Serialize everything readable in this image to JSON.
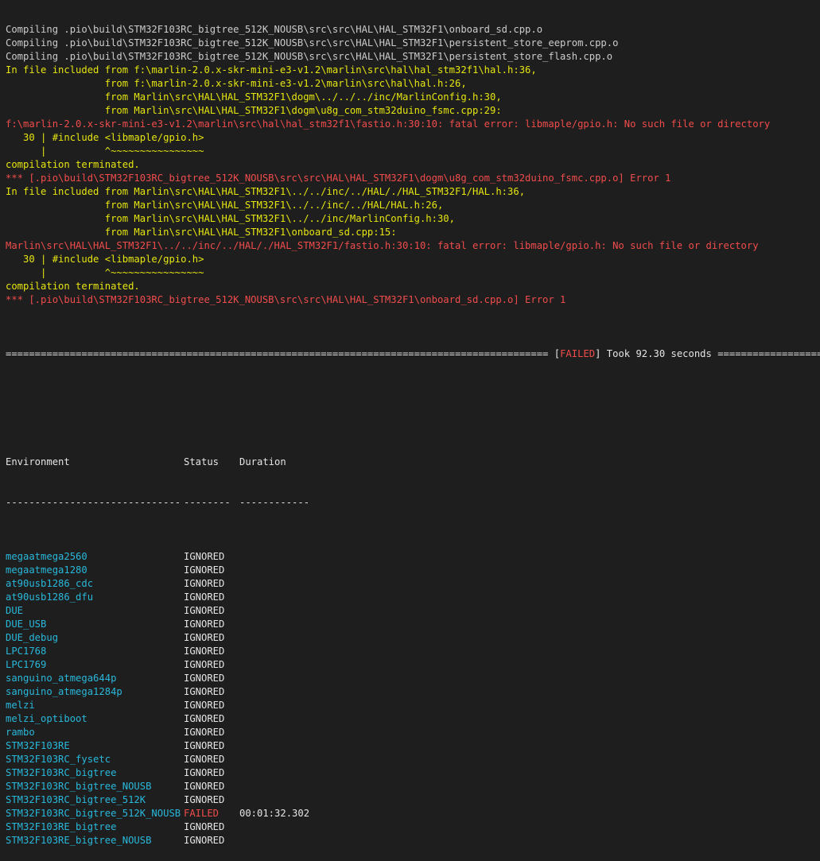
{
  "log": [
    {
      "t": "Compiling .pio\\build\\STM32F103RC_bigtree_512K_NOUSB\\src\\src\\HAL\\HAL_STM32F1\\onboard_sd.cpp.o",
      "c": "gray"
    },
    {
      "t": "Compiling .pio\\build\\STM32F103RC_bigtree_512K_NOUSB\\src\\src\\HAL\\HAL_STM32F1\\persistent_store_eeprom.cpp.o",
      "c": "gray"
    },
    {
      "t": "Compiling .pio\\build\\STM32F103RC_bigtree_512K_NOUSB\\src\\src\\HAL\\HAL_STM32F1\\persistent_store_flash.cpp.o",
      "c": "gray"
    },
    {
      "t": "In file included from f:\\marlin-2.0.x-skr-mini-e3-v1.2\\marlin\\src\\hal\\hal_stm32f1\\hal.h:36,",
      "c": "yellow"
    },
    {
      "t": "                 from f:\\marlin-2.0.x-skr-mini-e3-v1.2\\marlin\\src\\hal\\hal.h:26,",
      "c": "yellow"
    },
    {
      "t": "                 from Marlin\\src\\HAL\\HAL_STM32F1\\dogm\\../../../inc/MarlinConfig.h:30,",
      "c": "yellow"
    },
    {
      "t": "                 from Marlin\\src\\HAL\\HAL_STM32F1\\dogm\\u8g_com_stm32duino_fsmc.cpp:29:",
      "c": "yellow"
    },
    {
      "t": "f:\\marlin-2.0.x-skr-mini-e3-v1.2\\marlin\\src\\hal\\hal_stm32f1\\fastio.h:30:10: fatal error: libmaple/gpio.h: No such file or directory",
      "c": "red"
    },
    {
      "t": "   30 | #include <libmaple/gpio.h>",
      "c": "yellow"
    },
    {
      "t": "      |          ^~~~~~~~~~~~~~~~~",
      "c": "yellow"
    },
    {
      "t": "compilation terminated.",
      "c": "yellow"
    },
    {
      "t": "*** [.pio\\build\\STM32F103RC_bigtree_512K_NOUSB\\src\\src\\HAL\\HAL_STM32F1\\dogm\\u8g_com_stm32duino_fsmc.cpp.o] Error 1",
      "c": "red"
    },
    {
      "t": "In file included from Marlin\\src\\HAL\\HAL_STM32F1\\../../inc/../HAL/./HAL_STM32F1/HAL.h:36,",
      "c": "yellow"
    },
    {
      "t": "                 from Marlin\\src\\HAL\\HAL_STM32F1\\../../inc/../HAL/HAL.h:26,",
      "c": "yellow"
    },
    {
      "t": "                 from Marlin\\src\\HAL\\HAL_STM32F1\\../../inc/MarlinConfig.h:30,",
      "c": "yellow"
    },
    {
      "t": "                 from Marlin\\src\\HAL\\HAL_STM32F1\\onboard_sd.cpp:15:",
      "c": "yellow"
    },
    {
      "t": "Marlin\\src\\HAL\\HAL_STM32F1\\../../inc/../HAL/./HAL_STM32F1/fastio.h:30:10: fatal error: libmaple/gpio.h: No such file or directory",
      "c": "red"
    },
    {
      "t": "   30 | #include <libmaple/gpio.h>",
      "c": "yellow"
    },
    {
      "t": "      |          ^~~~~~~~~~~~~~~~~",
      "c": "yellow"
    },
    {
      "t": "compilation terminated.",
      "c": "yellow"
    },
    {
      "t": "*** [.pio\\build\\STM32F103RC_bigtree_512K_NOUSB\\src\\src\\HAL\\HAL_STM32F1\\onboard_sd.cpp.o] Error 1",
      "c": "red"
    }
  ],
  "summary": {
    "rule_left": "=============================================================================================",
    "bracket_open": "[",
    "failed": "FAILED",
    "took": "] Took 92.30 seconds ",
    "rule_right": "=================================="
  },
  "table": {
    "headers": {
      "environment": "Environment",
      "status": "Status",
      "duration": "Duration"
    },
    "dividers": {
      "environment": "------------------------------",
      "status": "--------",
      "duration": "------------"
    },
    "rows": [
      {
        "env": "megaatmega2560",
        "status": "IGNORED",
        "duration": ""
      },
      {
        "env": "megaatmega1280",
        "status": "IGNORED",
        "duration": ""
      },
      {
        "env": "at90usb1286_cdc",
        "status": "IGNORED",
        "duration": ""
      },
      {
        "env": "at90usb1286_dfu",
        "status": "IGNORED",
        "duration": ""
      },
      {
        "env": "DUE",
        "status": "IGNORED",
        "duration": ""
      },
      {
        "env": "DUE_USB",
        "status": "IGNORED",
        "duration": ""
      },
      {
        "env": "DUE_debug",
        "status": "IGNORED",
        "duration": ""
      },
      {
        "env": "LPC1768",
        "status": "IGNORED",
        "duration": ""
      },
      {
        "env": "LPC1769",
        "status": "IGNORED",
        "duration": ""
      },
      {
        "env": "sanguino_atmega644p",
        "status": "IGNORED",
        "duration": ""
      },
      {
        "env": "sanguino_atmega1284p",
        "status": "IGNORED",
        "duration": ""
      },
      {
        "env": "melzi",
        "status": "IGNORED",
        "duration": ""
      },
      {
        "env": "melzi_optiboot",
        "status": "IGNORED",
        "duration": ""
      },
      {
        "env": "rambo",
        "status": "IGNORED",
        "duration": ""
      },
      {
        "env": "STM32F103RE",
        "status": "IGNORED",
        "duration": ""
      },
      {
        "env": "STM32F103RC_fysetc",
        "status": "IGNORED",
        "duration": ""
      },
      {
        "env": "STM32F103RC_bigtree",
        "status": "IGNORED",
        "duration": ""
      },
      {
        "env": "STM32F103RC_bigtree_NOUSB",
        "status": "IGNORED",
        "duration": ""
      },
      {
        "env": "STM32F103RC_bigtree_512K",
        "status": "IGNORED",
        "duration": ""
      },
      {
        "env": "STM32F103RC_bigtree_512K_NOUSB",
        "status": "FAILED",
        "duration": "00:01:32.302"
      },
      {
        "env": "STM32F103RE_bigtree",
        "status": "IGNORED",
        "duration": ""
      },
      {
        "env": "STM32F103RE_bigtree_NOUSB",
        "status": "IGNORED",
        "duration": ""
      }
    ]
  },
  "colors": {
    "background": "#1e1e1e",
    "text": "#cccccc",
    "warning": "#e5e510",
    "error": "#f14c4c",
    "environment": "#29b8db"
  }
}
